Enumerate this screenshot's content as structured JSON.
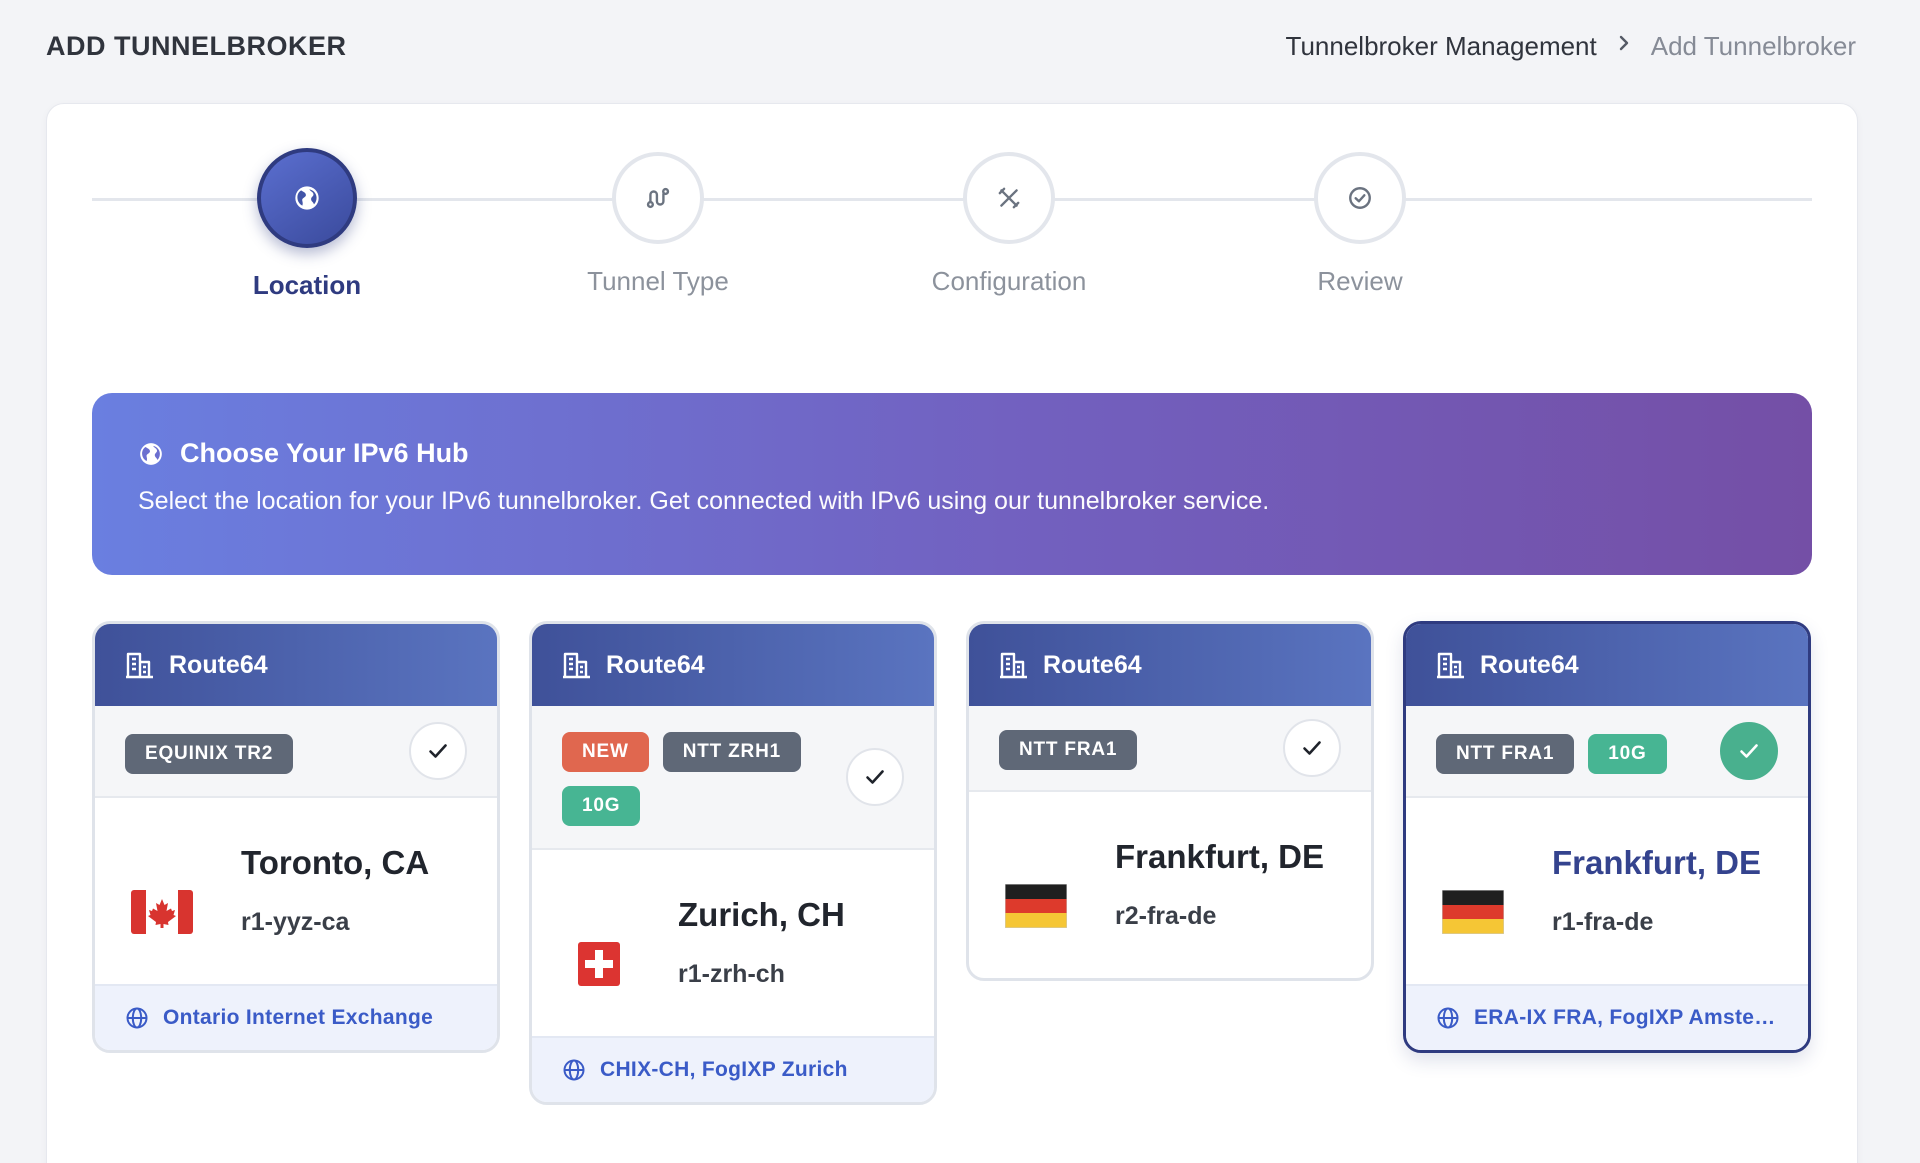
{
  "page": {
    "title": "ADD TUNNELBROKER",
    "breadcrumb": {
      "parent": "Tunnelbroker Management",
      "current": "Add Tunnelbroker"
    }
  },
  "stepper": {
    "steps": [
      {
        "label": "Location",
        "icon": "globe-icon",
        "active": true
      },
      {
        "label": "Tunnel Type",
        "icon": "route-icon",
        "active": false
      },
      {
        "label": "Configuration",
        "icon": "tools-icon",
        "active": false
      },
      {
        "label": "Review",
        "icon": "check-circle-icon",
        "active": false
      }
    ]
  },
  "banner": {
    "title": "Choose Your IPv6 Hub",
    "description": "Select the location for your IPv6 tunnelbroker. Get connected with IPv6 using our tunnelbroker service."
  },
  "locations": [
    {
      "provider": "Route64",
      "badges": [
        "EQUINIX TR2"
      ],
      "city": "Toronto, CA",
      "router": "r1-yyz-ca",
      "flag": "canada-flag",
      "exchanges": "Ontario Internet Exchange",
      "selected": false
    },
    {
      "provider": "Route64",
      "badges": [
        "NEW",
        "NTT ZRH1",
        "10G"
      ],
      "city": "Zurich, CH",
      "router": "r1-zrh-ch",
      "flag": "switzerland-flag",
      "exchanges": "CHIX-CH, FogIXP Zurich",
      "selected": false
    },
    {
      "provider": "Route64",
      "badges": [
        "NTT FRA1"
      ],
      "city": "Frankfurt, DE",
      "router": "r2-fra-de",
      "flag": "germany-flag",
      "exchanges": "",
      "selected": false
    },
    {
      "provider": "Route64",
      "badges": [
        "NTT FRA1",
        "10G"
      ],
      "city": "Frankfurt, DE",
      "router": "r1-fra-de",
      "flag": "germany-flag",
      "exchanges": "ERA-IX FRA, FogIXP Amster...",
      "selected": true
    }
  ],
  "colors": {
    "accent": "#2f3b80",
    "banner_start": "#6a7fe0",
    "banner_end": "#744fa6",
    "badge_new": "#e0674f",
    "badge_speed": "#47b593",
    "badge_default": "#5f6877",
    "selected_check": "#49b08e",
    "exchange_text": "#3a5bc7"
  }
}
